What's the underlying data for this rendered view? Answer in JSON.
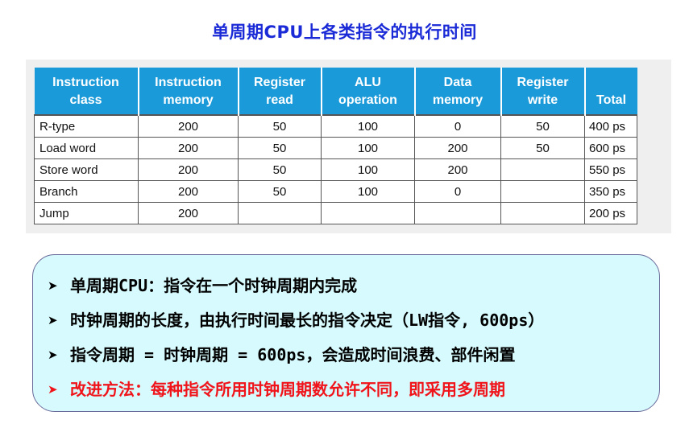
{
  "title": "单周期CPU上各类指令的执行时间",
  "table": {
    "headers": [
      [
        "Instruction",
        "class"
      ],
      [
        "Instruction",
        "memory"
      ],
      [
        "Register",
        "read"
      ],
      [
        "ALU",
        "operation"
      ],
      [
        "Data",
        "memory"
      ],
      [
        "Register",
        "write"
      ],
      [
        "",
        "Total"
      ]
    ],
    "rows": [
      [
        "R-type",
        "200",
        "50",
        "100",
        "0",
        "50",
        "400 ps"
      ],
      [
        "Load word",
        "200",
        "50",
        "100",
        "200",
        "50",
        "600 ps"
      ],
      [
        "Store word",
        "200",
        "50",
        "100",
        "200",
        "",
        "550 ps"
      ],
      [
        "Branch",
        "200",
        "50",
        "100",
        "0",
        "",
        "350 ps"
      ],
      [
        "Jump",
        "200",
        "",
        "",
        "",
        "",
        "200 ps"
      ]
    ]
  },
  "notes": [
    {
      "text": "单周期CPU：指令在一个时钟周期内完成",
      "color": "#000000"
    },
    {
      "text": "时钟周期的长度，由执行时间最长的指令决定（LW指令, 600ps）",
      "color": "#000000"
    },
    {
      "text": "指令周期 = 时钟周期 = 600ps，会造成时间浪费、部件闲置",
      "color": "#000000"
    },
    {
      "text": "改进方法：每种指令所用时钟周期数允许不同，即采用多周期",
      "color": "#f0141a"
    }
  ],
  "bullet_icon": "arrow-bullet-icon"
}
